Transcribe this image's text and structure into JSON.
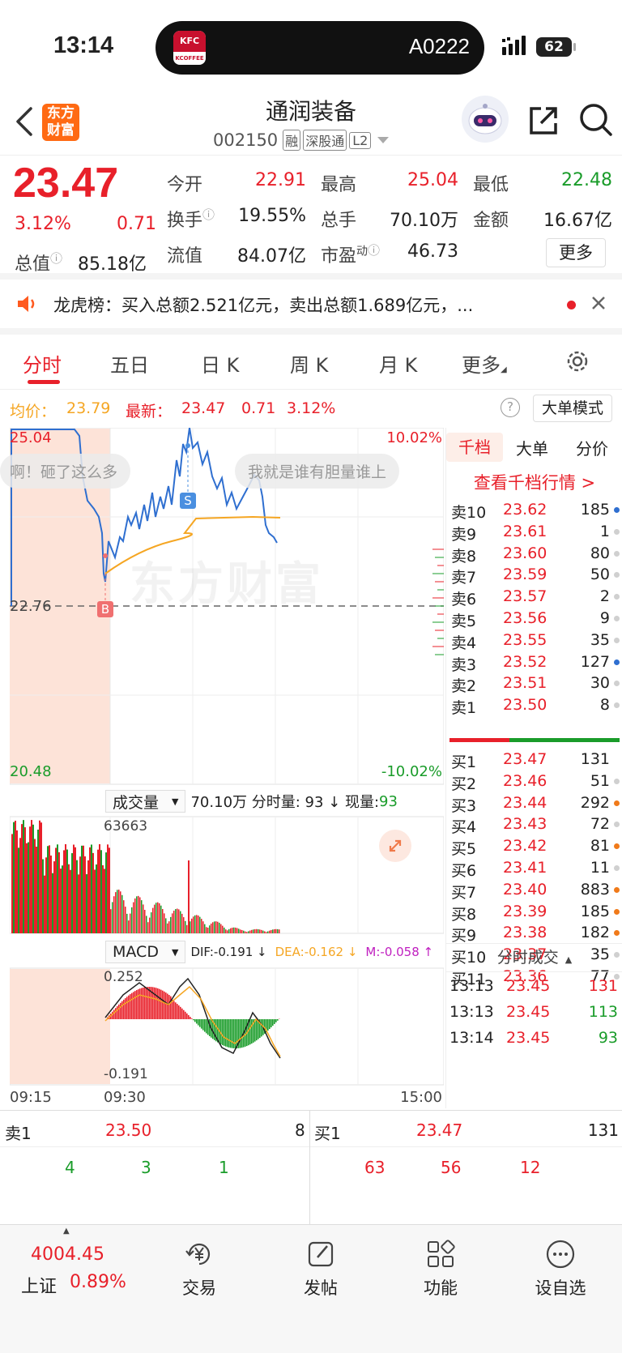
{
  "status_bar": {
    "time": "13:14",
    "island_brand_top": "KFC",
    "island_brand_bottom": "KCOFFEE",
    "island_code": "A0222",
    "battery": "62"
  },
  "header": {
    "logo": "东方财富",
    "logo_line1": "东方",
    "logo_line2": "财富",
    "title": "通润装备",
    "code": "002150",
    "tag_rong": "融",
    "tag_sgt": "深股通",
    "tag_l2": "L2"
  },
  "quote": {
    "price": "23.47",
    "change_pct": "3.12%",
    "change": "0.71",
    "open_label": "今开",
    "open": "22.91",
    "high_label": "最高",
    "high": "25.04",
    "low_label": "最低",
    "low": "22.48",
    "turnover_label": "换手",
    "turnover": "19.55%",
    "volume_label": "总手",
    "volume": "70.10万",
    "amount_label": "金额",
    "amount": "16.67亿",
    "mktcap_label": "总值",
    "mktcap": "85.18亿",
    "float_label": "流值",
    "float_cap": "84.07亿",
    "pe_label": "市盈",
    "pe_sup": "动",
    "pe": "46.73",
    "more_button": "更多"
  },
  "news": {
    "text": "龙虎榜：买入总额2.521亿元，卖出总额1.689亿元，..."
  },
  "tabs": {
    "items": [
      "分时",
      "五日",
      "日 K",
      "周 K",
      "月 K",
      "更多"
    ],
    "active": 0
  },
  "chart_info": {
    "avg_label": "均价：",
    "avg": "23.79",
    "latest_label": "最新：",
    "latest": "23.47",
    "change": "0.71",
    "change_pct": "3.12%",
    "big_order_button": "大单模式"
  },
  "chart_labels": {
    "y_top": "25.04",
    "y_mid": "22.76",
    "y_bottom": "20.48",
    "pct_top": "10.02%",
    "pct_bottom": "-10.02%",
    "bubble1": "啊！砸了这么多",
    "bubble2": "我就是谁有胆量谁上",
    "watermark": "东方财富",
    "marker_s": "S",
    "marker_b": "B"
  },
  "volume_bar": {
    "dropdown": "成交量",
    "summary": "70.10万 分时量: 93 ↓ 现量: ",
    "current": "93",
    "max_label": "63663"
  },
  "macd_bar": {
    "dropdown": "MACD",
    "dif": "DIF:-0.191 ↓",
    "dea": "DEA:-0.162 ↓",
    "m": "M:-0.058 ↑",
    "top": "0.252",
    "bottom": "-0.191"
  },
  "time_axis": {
    "t0": "09:15",
    "t1": "09:30",
    "t2": "15:00"
  },
  "right_tabs": {
    "items": [
      "千档",
      "大单",
      "分价"
    ],
    "active": 0,
    "link": "查看千档行情 >"
  },
  "sell_orders": [
    {
      "label": "卖10",
      "price": "23.62",
      "vol": "185",
      "dot": "#2f6fd0"
    },
    {
      "label": "卖9",
      "price": "23.61",
      "vol": "1",
      "dot": "#d0d0d0"
    },
    {
      "label": "卖8",
      "price": "23.60",
      "vol": "80",
      "dot": "#d0d0d0"
    },
    {
      "label": "卖7",
      "price": "23.59",
      "vol": "50",
      "dot": "#d0d0d0"
    },
    {
      "label": "卖6",
      "price": "23.57",
      "vol": "2",
      "dot": "#d0d0d0"
    },
    {
      "label": "卖5",
      "price": "23.56",
      "vol": "9",
      "dot": "#d0d0d0"
    },
    {
      "label": "卖4",
      "price": "23.55",
      "vol": "35",
      "dot": "#d0d0d0"
    },
    {
      "label": "卖3",
      "price": "23.52",
      "vol": "127",
      "dot": "#2f6fd0"
    },
    {
      "label": "卖2",
      "price": "23.51",
      "vol": "30",
      "dot": "#d0d0d0"
    },
    {
      "label": "卖1",
      "price": "23.50",
      "vol": "8",
      "dot": "#d0d0d0"
    }
  ],
  "buy_orders": [
    {
      "label": "买1",
      "price": "23.47",
      "vol": "131",
      "dot": "#ffffff"
    },
    {
      "label": "买2",
      "price": "23.46",
      "vol": "51",
      "dot": "#d0d0d0"
    },
    {
      "label": "买3",
      "price": "23.44",
      "vol": "292",
      "dot": "#f07a1a"
    },
    {
      "label": "买4",
      "price": "23.43",
      "vol": "72",
      "dot": "#d0d0d0"
    },
    {
      "label": "买5",
      "price": "23.42",
      "vol": "81",
      "dot": "#f07a1a"
    },
    {
      "label": "买6",
      "price": "23.41",
      "vol": "11",
      "dot": "#d0d0d0"
    },
    {
      "label": "买7",
      "price": "23.40",
      "vol": "883",
      "dot": "#f07a1a"
    },
    {
      "label": "买8",
      "price": "23.39",
      "vol": "185",
      "dot": "#f07a1a"
    },
    {
      "label": "买9",
      "price": "23.38",
      "vol": "182",
      "dot": "#f07a1a"
    },
    {
      "label": "买10",
      "price": "23.37",
      "vol": "35",
      "dot": "#d0d0d0"
    },
    {
      "label": "买11",
      "price": "23.36",
      "vol": "77",
      "dot": "#d0d0d0"
    }
  ],
  "ticks": {
    "title": "分时成交",
    "rows": [
      {
        "time": "13:13",
        "price": "23.45",
        "vol": "131",
        "color": "#e8202a"
      },
      {
        "time": "13:13",
        "price": "23.45",
        "vol": "113",
        "color": "#1a9c2a"
      },
      {
        "time": "13:14",
        "price": "23.45",
        "vol": "93",
        "color": "#1a9c2a"
      }
    ]
  },
  "bottom_quote": {
    "sell_label": "卖1",
    "sell_price": "23.50",
    "sell_vol": "8",
    "buy_label": "买1",
    "buy_price": "23.47",
    "buy_vol": "131",
    "sell_queue": [
      "4",
      "3",
      "1"
    ],
    "buy_queue": [
      "63",
      "56",
      "12"
    ]
  },
  "bottom_nav": {
    "index_value": "4004.45",
    "index_name": "上证",
    "index_pct": "0.89%",
    "trade": "交易",
    "post": "发帖",
    "functions": "功能",
    "watchlist": "设自选"
  },
  "colors": {
    "up": "#e8202a",
    "down": "#1a9c2a",
    "price_line": "#2f6fd0",
    "avg_line": "#f5a623",
    "pre_market_bg": "#fde3d8",
    "accent": "#e8202a"
  }
}
